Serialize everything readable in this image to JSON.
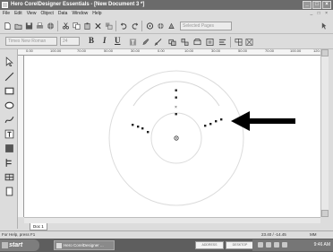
{
  "window": {
    "title": "Hero CorelDesigner Essentials - [New Document 3 *]",
    "buttons": {
      "minimize": "_",
      "maximize": "□",
      "close": "×"
    }
  },
  "menu": {
    "items": [
      "File",
      "Edit",
      "View",
      "Object",
      "Data",
      "Window",
      "Help"
    ],
    "mdi_controls": "_ □ ×"
  },
  "toolbar": {
    "search_placeholder": "Selected Pages",
    "font_field": "Times New Roman",
    "size_field": "24",
    "bold": "B",
    "italic": "I",
    "underline": "U"
  },
  "ruler": {
    "labels": [
      "0.00",
      "100.00",
      "70.00",
      "50.00",
      "30.00",
      "0.00",
      "10.00",
      "30.00",
      "50.00",
      "70.00",
      "100.00",
      "120.0"
    ]
  },
  "page_tab": {
    "label": "Doc 1"
  },
  "status": {
    "left": "For Help, press F1",
    "coords": "23.40 / -14.45",
    "unit": "MM"
  },
  "taskbar": {
    "start": "start",
    "task_item": "Hero CorelDesigner ...",
    "tray_boxes": [
      "ADDRESS",
      "DESKTOP"
    ],
    "clock": "9:46 AM"
  },
  "colors": {
    "arrow": "#000000",
    "circle_line": "#d6d6d6",
    "title_bar": "#6b6b6b"
  }
}
